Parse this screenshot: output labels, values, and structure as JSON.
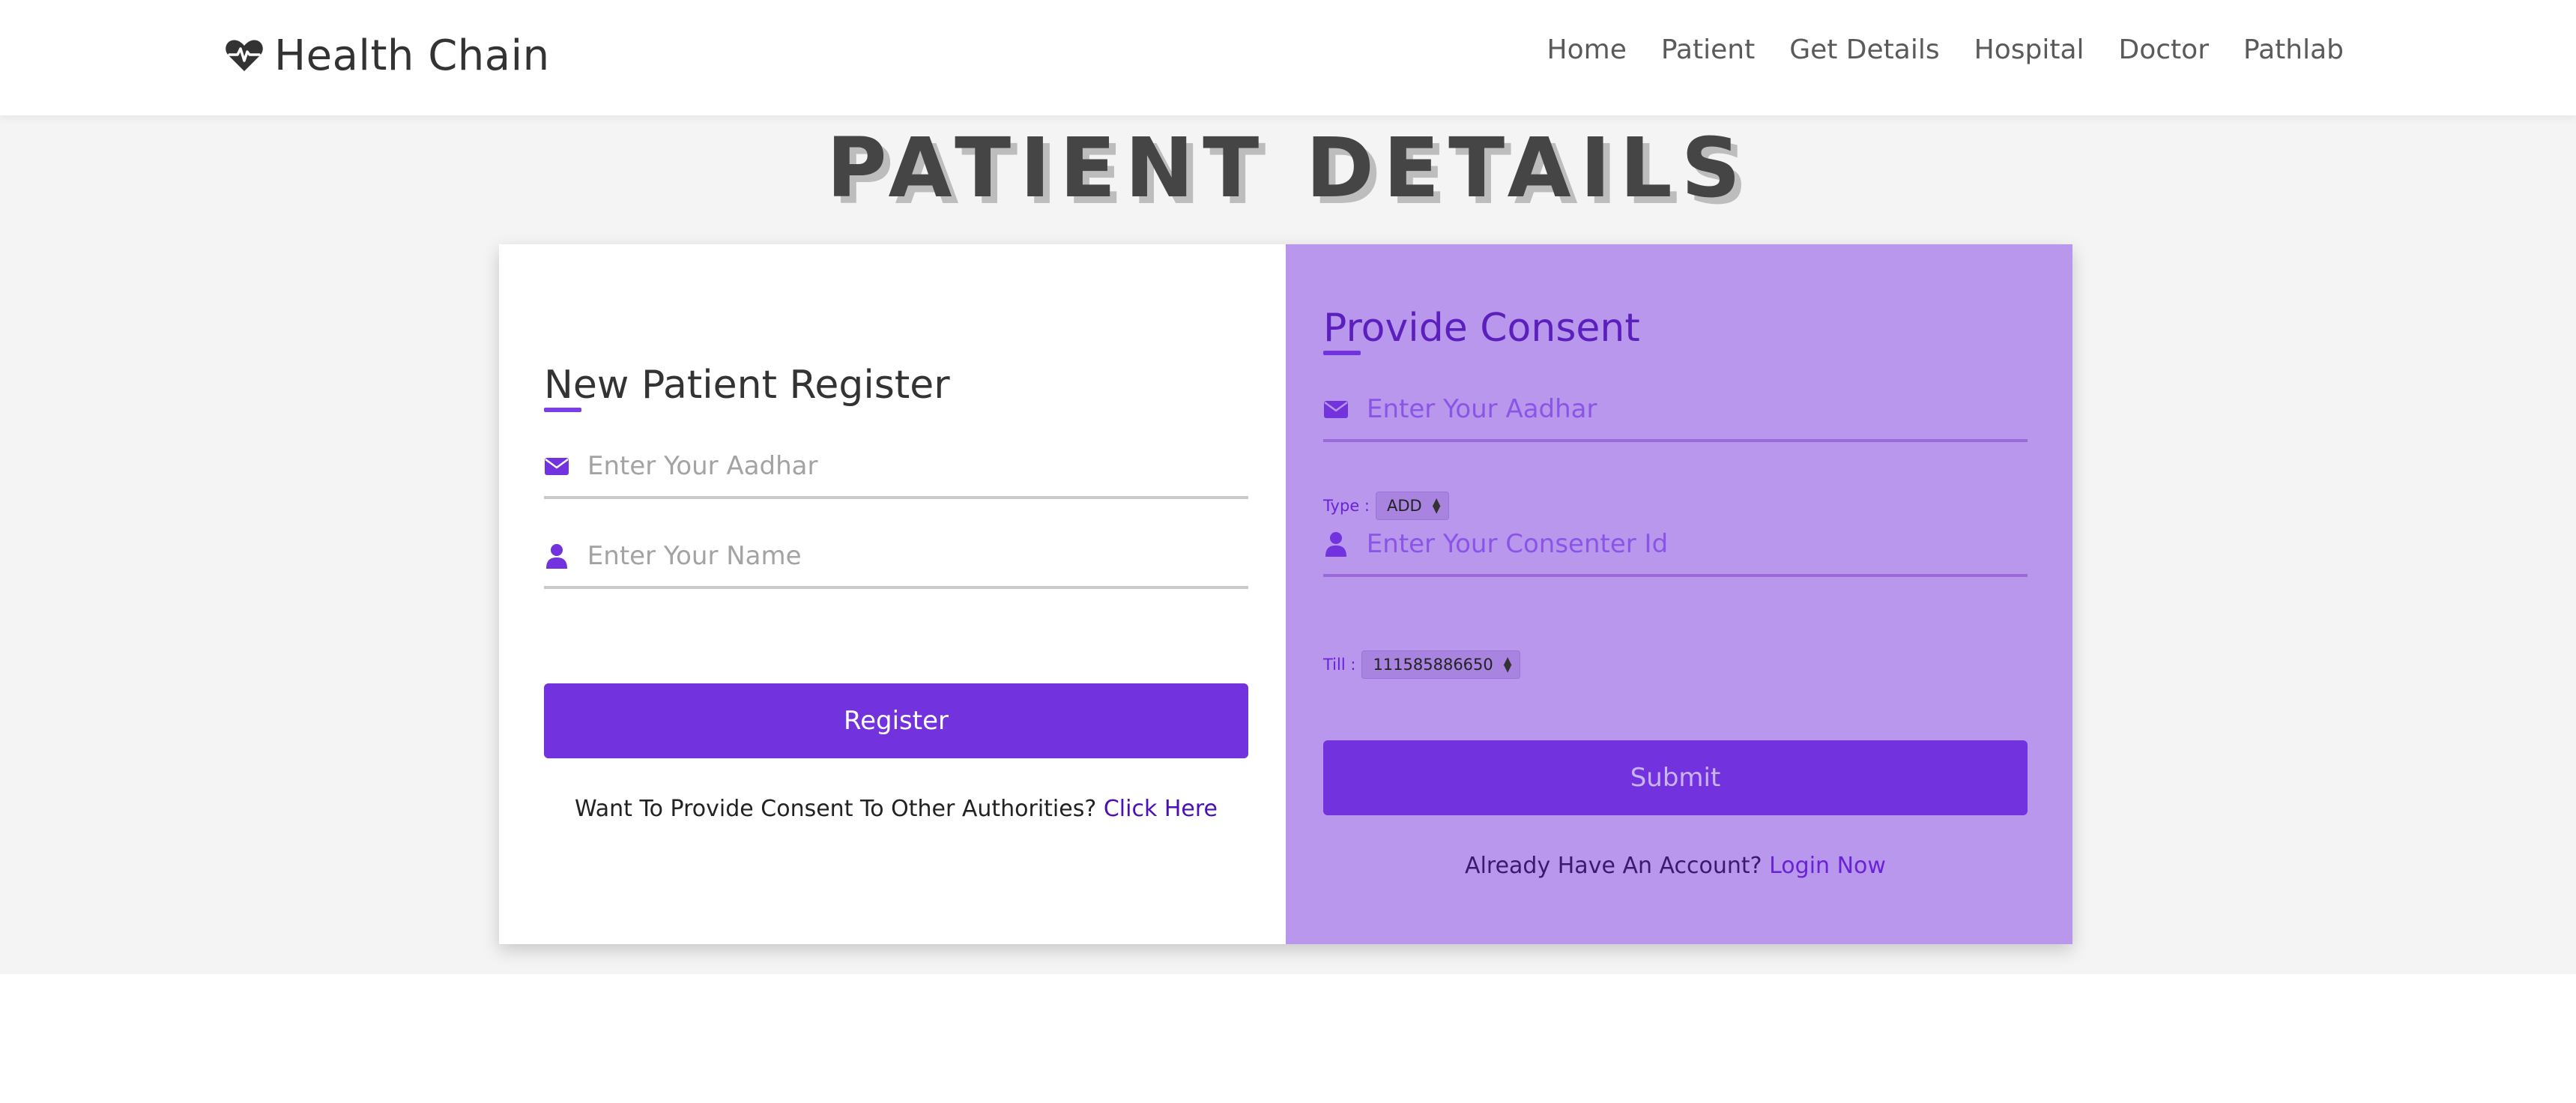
{
  "navbar": {
    "brand": "Health Chain",
    "brand_icon": "heartbeat-icon",
    "links": [
      "Home",
      "Patient",
      "Get Details",
      "Hospital",
      "Doctor",
      "Pathlab"
    ]
  },
  "page": {
    "title": "PATIENT DETAILS"
  },
  "register_panel": {
    "heading": "New Patient Register",
    "aadhar_placeholder": "Enter Your Aadhar",
    "name_placeholder": "Enter Your Name",
    "button_label": "Register",
    "footnote_text": "Want To Provide Consent To Other Authorities?",
    "footnote_link": "Click Here"
  },
  "consent_panel": {
    "heading": "Provide Consent",
    "aadhar_placeholder": "Enter Your Aadhar",
    "type_label": "Type :",
    "type_value": "ADD",
    "consenter_placeholder": "Enter Your Consenter Id",
    "till_label": "Till :",
    "till_value": "111585886650",
    "button_label": "Submit",
    "footnote_text": "Already Have An Account?",
    "footnote_link": "Login Now"
  },
  "colors": {
    "accent": "#7232de",
    "consent_bg": "#b897ec",
    "page_bg": "#f4f4f4"
  }
}
